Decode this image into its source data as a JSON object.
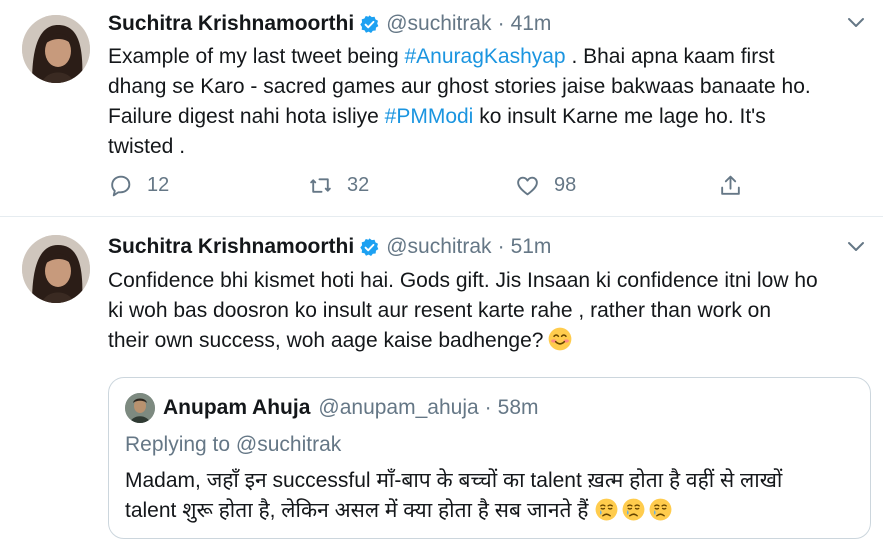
{
  "tweets": [
    {
      "name": "Suchitra Krishnamoorthi",
      "handle": "@suchitrak",
      "dot": "·",
      "time": "41m",
      "text_lines": [
        {
          "pre": "Example of my last tweet being ",
          "link": "#AnuragKashyap",
          "post": " . Bhai apna kaam first"
        },
        {
          "pre": "dhang se Karo - sacred games aur ghost stories jaise bakwaas banaate ho."
        },
        {
          "pre": "Failure digest nahi hota isliye ",
          "link": "#PMModi",
          "post": " ko insult Karne me lage ho. It's"
        },
        {
          "pre": "twisted ."
        }
      ],
      "replies": "12",
      "retweets": "32",
      "likes": "98"
    },
    {
      "name": "Suchitra Krishnamoorthi",
      "handle": "@suchitrak",
      "dot": "·",
      "time": "51m",
      "text_lines": [
        "Confidence bhi kismet hoti hai. Gods gift. Jis Insaan ki confidence itni low ho",
        "ki woh bas doosron ko insult aur  resent karte rahe , rather than work on",
        "their own success,  woh aage kaise  badhenge?"
      ],
      "quote": {
        "name": "Anupam Ahuja",
        "handle": "@anupam_ahuja",
        "dot": "·",
        "time": "58m",
        "replying": "Replying to @suchitrak",
        "text_lines": [
          "Madam, जहाँ इन successful माँ-बाप के बच्चों का talent ख़त्म होता है वहीं से लाखों",
          "talent शुरू होता है, लेकिन असल में क्या होता है सब जानते हैं"
        ]
      }
    }
  ],
  "colors": {
    "link": "#1b95e0",
    "secondary": "#657786",
    "border": "#ccd6dd",
    "verified": "#1da1f2"
  },
  "icons": [
    "verified-badge-icon",
    "caret-down-icon",
    "reply-icon",
    "retweet-icon",
    "like-icon",
    "share-icon",
    "smiling-emoji-icon",
    "crying-emoji-icon"
  ]
}
